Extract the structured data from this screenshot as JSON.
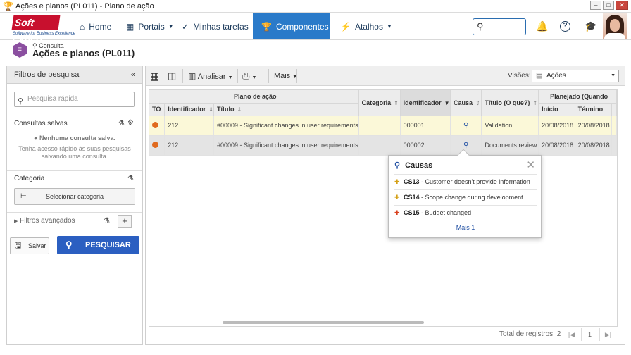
{
  "window": {
    "title": "Ações e planos (PL011) - Plano de ação"
  },
  "logo": {
    "name": "Soft Expert",
    "tagline": "Software for Business Excellence"
  },
  "nav": {
    "home": "Home",
    "portais": "Portais",
    "minhas_tarefas": "Minhas tarefas",
    "componentes": "Componentes",
    "atalhos": "Atalhos",
    "active_color": "#2a7ac9"
  },
  "header": {
    "breadcrumb": "Consulta",
    "title": "Ações e planos (PL011)"
  },
  "filters": {
    "panel_title": "Filtros de pesquisa",
    "quick_search_placeholder": "Pesquisa rápida",
    "saved_title": "Consultas salvas",
    "saved_empty": "Nenhuma consulta salva.",
    "saved_hint_line1": "Tenha acesso rápido às suas pesquisas",
    "saved_hint_line2": "salvando uma consulta.",
    "category_title": "Categoria",
    "select_category": "Selecionar categoria",
    "advanced": "Filtros avançados",
    "save_button": "Salvar",
    "search_button": "PESQUISAR",
    "search_color": "#2b5fc1"
  },
  "toolbar": {
    "analisar": "Analisar",
    "mais": "Mais",
    "views_label": "Visões:",
    "views_value": "Ações"
  },
  "grid": {
    "group_plano": "Plano de ação",
    "group_planejado": "Planejado (Quando",
    "columns": {
      "to": "TO",
      "identificador": "Identificador",
      "titulo": "Título",
      "categoria": "Categoria",
      "identificador2": "Identificador",
      "causa": "Causa",
      "titulo_o_que": "Título (O que?)",
      "inicio": "Início",
      "termino": "Término"
    },
    "rows": [
      {
        "plan_id": "212",
        "plan_title": "#00009 - Significant changes in user requirements",
        "categoria": "",
        "id": "000001",
        "titulo": "Validation",
        "inicio": "20/08/2018",
        "termino": "20/08/2018"
      },
      {
        "plan_id": "212",
        "plan_title": "#00009 - Significant changes in user requirements",
        "categoria": "",
        "id": "000002",
        "titulo": "Documents review",
        "inicio": "20/08/2018",
        "termino": "20/08/2018"
      }
    ],
    "total": "Total de registros: 2",
    "page": "1"
  },
  "popup": {
    "title": "Causas",
    "items": [
      {
        "code": "CS13",
        "text": " - Customer doesn't provide information"
      },
      {
        "code": "CS14",
        "text": " - Scope change during development"
      },
      {
        "code": "CS15",
        "text": " - Budget changed"
      }
    ],
    "more": "Mais 1"
  }
}
